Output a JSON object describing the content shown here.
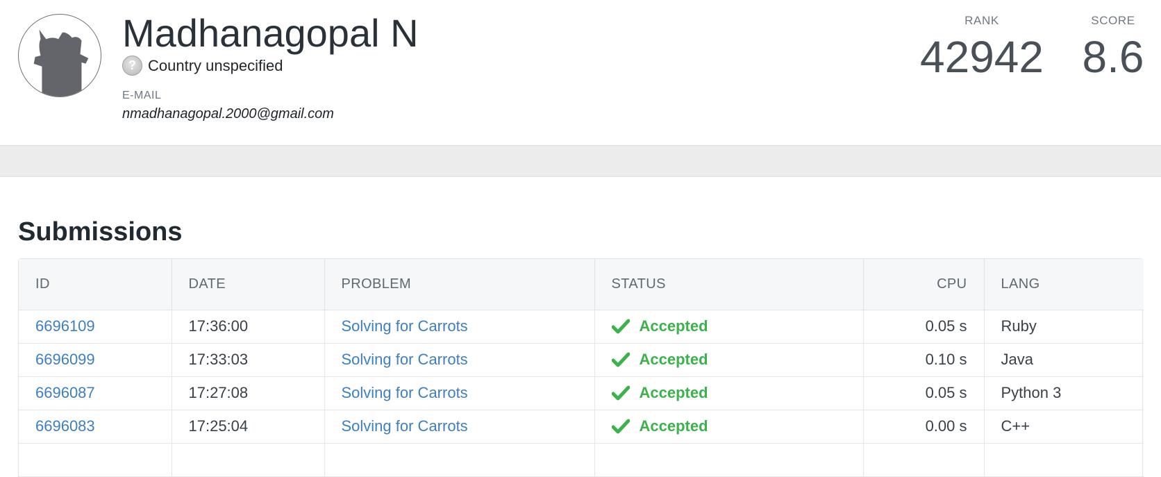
{
  "profile": {
    "name": "Madhanagopal N",
    "country": "Country unspecified",
    "country_icon": "question-mark-icon",
    "email_label": "E-MAIL",
    "email": "nmadhanagopal.2000@gmail.com"
  },
  "stats": {
    "rank_label": "RANK",
    "rank": "42942",
    "score_label": "SCORE",
    "score": "8.6"
  },
  "submissions": {
    "title": "Submissions",
    "columns": {
      "id": "ID",
      "date": "DATE",
      "problem": "PROBLEM",
      "status": "STATUS",
      "cpu": "CPU",
      "lang": "LANG"
    },
    "rows": [
      {
        "id": "6696109",
        "date": "17:36:00",
        "problem": "Solving for Carrots",
        "status": "Accepted",
        "cpu": "0.05 s",
        "lang": "Ruby"
      },
      {
        "id": "6696099",
        "date": "17:33:03",
        "problem": "Solving for Carrots",
        "status": "Accepted",
        "cpu": "0.10 s",
        "lang": "Java"
      },
      {
        "id": "6696087",
        "date": "17:27:08",
        "problem": "Solving for Carrots",
        "status": "Accepted",
        "cpu": "0.05 s",
        "lang": "Python 3"
      },
      {
        "id": "6696083",
        "date": "17:25:04",
        "problem": "Solving for Carrots",
        "status": "Accepted",
        "cpu": "0.00 s",
        "lang": "C++"
      }
    ]
  },
  "colors": {
    "link": "#3d7fc1",
    "accepted": "#3bb34a"
  }
}
